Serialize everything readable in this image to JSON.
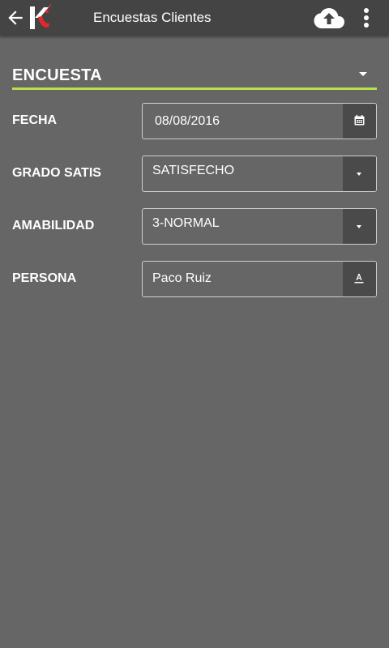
{
  "app_bar": {
    "title": "Encuestas Clientes",
    "back_icon": "arrow-left-icon",
    "logo_icon": "k-logo-icon",
    "upload_icon": "cloud-upload-icon",
    "more_icon": "more-vert-icon"
  },
  "section": {
    "title": "ENCUESTA",
    "accent_color": "#b7e04a"
  },
  "form": {
    "fecha": {
      "label": "FECHA",
      "value": "08/08/2016",
      "icon": "calendar-icon"
    },
    "grado_satis": {
      "label": "GRADO SATIS",
      "value": "SATISFECHO",
      "icon": "caret-down-icon"
    },
    "amabilidad": {
      "label": "AMABILIDAD",
      "value": "3-NORMAL",
      "icon": "caret-down-icon"
    },
    "persona": {
      "label": "PERSONA",
      "value": "Paco Ruiz",
      "icon": "text-format-icon"
    }
  },
  "colors": {
    "background": "#666666",
    "app_bar": "#444444",
    "field_button": "#4a4a4a",
    "logo_red": "#e8262a"
  }
}
